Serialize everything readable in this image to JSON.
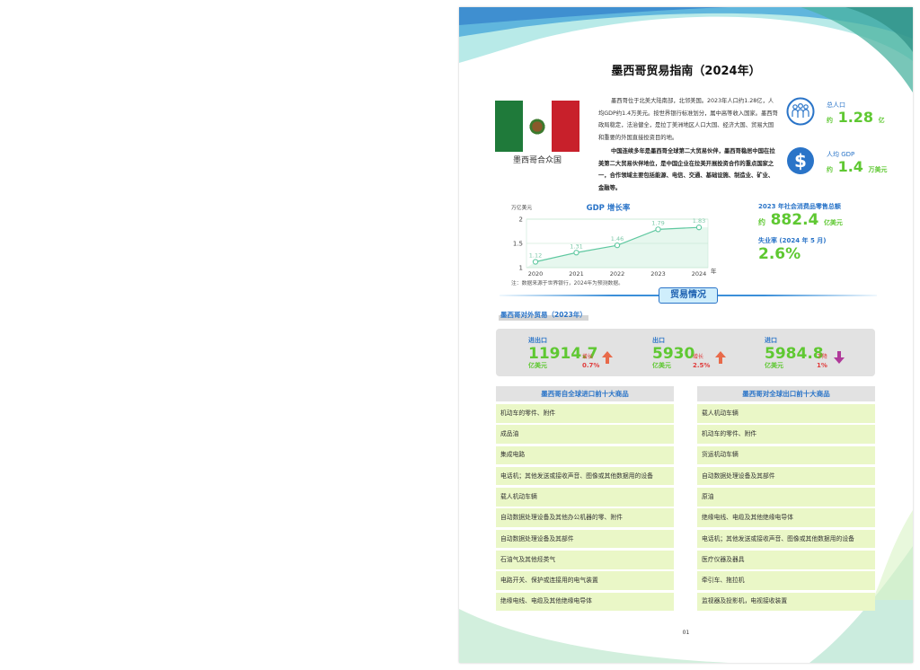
{
  "doc": {
    "title": "墨西哥贸易指南（2024年）",
    "flag_caption": "墨西哥合众国",
    "intro_p1": "墨西哥位于北美大陆南部，北邻美国。2023年人口约1.28亿，人均GDP约1.4万美元。按世界银行标准划分，属中高等收入国家。墨西哥政局稳定，法治健全，是拉丁美洲地区人口大国、经济大国、贸易大国和重要的外国直接投资目的地。",
    "intro_p2": "中国连续多年是墨西哥全球第二大贸易伙伴，墨西哥稳居中国在拉美第二大贸易伙伴地位，是中国企业在拉美开展投资合作的重点国家之一，合作领域主要包括能源、电信、交通、基础设施、制造业、矿业、金融等。",
    "page_number": "01"
  },
  "colors": {
    "accent_blue": "#2a74c8",
    "accent_green": "#5fc832",
    "row_green": "#eaf7c7",
    "panel_gray": "#e2e2e2",
    "up_red": "#e03c3c",
    "down_purple": "#b03a9a"
  },
  "stats": {
    "population": {
      "icon": "people-icon",
      "label": "总人口",
      "prefix": "约",
      "value": "1.28",
      "unit": "亿"
    },
    "gdp_per_capita": {
      "icon": "dollar-icon",
      "label": "人均 GDP",
      "prefix": "约",
      "value": "1.4",
      "unit": "万美元"
    }
  },
  "kpis": {
    "retail": {
      "label": "2023 年社会消费品零售总额",
      "prefix": "约",
      "value": "882.4",
      "unit": "亿美元"
    },
    "unemployment": {
      "label": "失业率 (2024 年 5 月)",
      "value": "2.6%"
    }
  },
  "chart_data": {
    "type": "line",
    "title": "GDP 增长率",
    "ylabel": "万亿美元",
    "xlabel": "年",
    "x": [
      "2020",
      "2021",
      "2022",
      "2023",
      "2024"
    ],
    "values": [
      1.12,
      1.31,
      1.46,
      1.79,
      1.83
    ],
    "data_labels": [
      "1.12",
      "1.31",
      "1.46",
      "1.79",
      "1.83"
    ],
    "yticks": [
      "1",
      "1.5",
      "2"
    ],
    "ylim": [
      1,
      2
    ],
    "grid": true,
    "line_color": "#5fc8a0",
    "note": "注：数据来源于世界银行，2024年为预测数据。"
  },
  "trade": {
    "section_title": "贸易情况",
    "subtitle": "墨西哥对外贸易（2023年）",
    "items": [
      {
        "label": "进出口",
        "value": "11914.7",
        "unit": "亿美元",
        "change_label": "增长",
        "change": "0.7%",
        "direction": "up-arrow-icon"
      },
      {
        "label": "出口",
        "value": "5930",
        "unit": "亿美元",
        "change_label": "增长",
        "change": "2.5%",
        "direction": "up-arrow-icon"
      },
      {
        "label": "进口",
        "value": "5984.8",
        "unit": "亿美元",
        "change_label": "下降",
        "change": "1%",
        "direction": "down-arrow-icon"
      }
    ]
  },
  "imports": {
    "title": "墨西哥自全球进口前十大商品",
    "items": [
      "机动车的零件、附件",
      "成品油",
      "集成电路",
      "电话机；其他发送或接收声音、图像或其他数据用的设备",
      "载人机动车辆",
      "自动数据处理设备及其他办公机器的零、附件",
      "自动数据处理设备及其部件",
      "石油气及其他烃类气",
      "电路开关、保护或连接用的电气装置",
      "绝缘电线、电缆及其他绝缘电导体"
    ]
  },
  "exports": {
    "title": "墨西哥对全球出口前十大商品",
    "items": [
      "载人机动车辆",
      "机动车的零件、附件",
      "货运机动车辆",
      "自动数据处理设备及其部件",
      "原油",
      "绝缘电线、电缆及其他绝缘电导体",
      "电话机；其他发送或接收声音、图像或其他数据用的设备",
      "医疗仪器及器具",
      "牵引车、拖拉机",
      "监视器及投影机，电视接收装置"
    ]
  }
}
